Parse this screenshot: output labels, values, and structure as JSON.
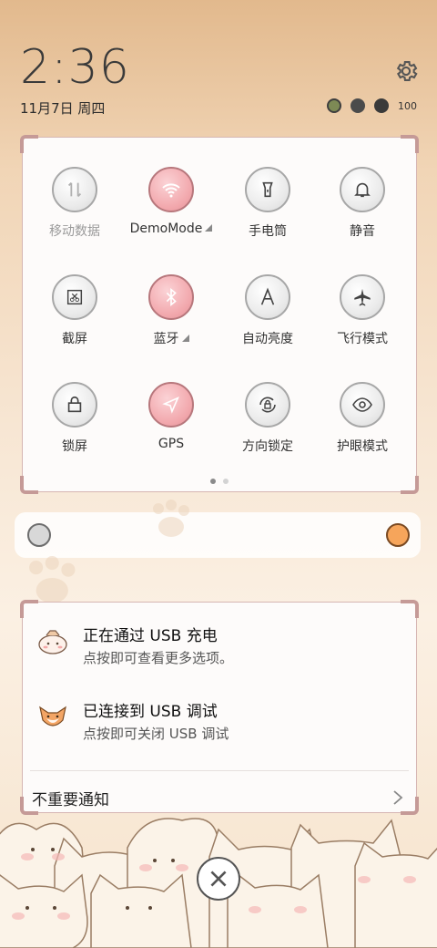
{
  "status": {
    "time": "2:36",
    "date": "11月7日 周四",
    "battery": "100"
  },
  "quick_settings": {
    "tiles": [
      {
        "label": "移动数据",
        "icon": "mobile-data-icon",
        "on": false,
        "dim": true
      },
      {
        "label": "DemoMode",
        "icon": "wifi-icon",
        "on": true,
        "expand": true
      },
      {
        "label": "手电筒",
        "icon": "flashlight-icon",
        "on": false
      },
      {
        "label": "静音",
        "icon": "bell-icon",
        "on": false
      },
      {
        "label": "截屏",
        "icon": "screenshot-icon",
        "on": false
      },
      {
        "label": "蓝牙",
        "icon": "bluetooth-icon",
        "on": true,
        "expand": true
      },
      {
        "label": "自动亮度",
        "icon": "auto-brightness-icon",
        "on": false
      },
      {
        "label": "飞行模式",
        "icon": "airplane-icon",
        "on": false
      },
      {
        "label": "锁屏",
        "icon": "lock-icon",
        "on": false
      },
      {
        "label": "GPS",
        "icon": "location-icon",
        "on": true
      },
      {
        "label": "方向锁定",
        "icon": "rotation-lock-icon",
        "on": false
      },
      {
        "label": "护眼模式",
        "icon": "eye-icon",
        "on": false
      }
    ],
    "page_count": 2,
    "active_page": 1
  },
  "notifications": [
    {
      "title": "正在通过 USB 充电",
      "subtitle": "点按即可查看更多选项。",
      "icon": "cat-avatar-icon"
    },
    {
      "title": "已连接到 USB 调试",
      "subtitle": "点按即可关闭 USB 调试",
      "icon": "fox-avatar-icon"
    }
  ],
  "less_important_label": "不重要通知",
  "colors": {
    "tile_on": "#f2a8ad",
    "tile_off": "#ebebeb",
    "panel_border": "#d6b6b3"
  }
}
